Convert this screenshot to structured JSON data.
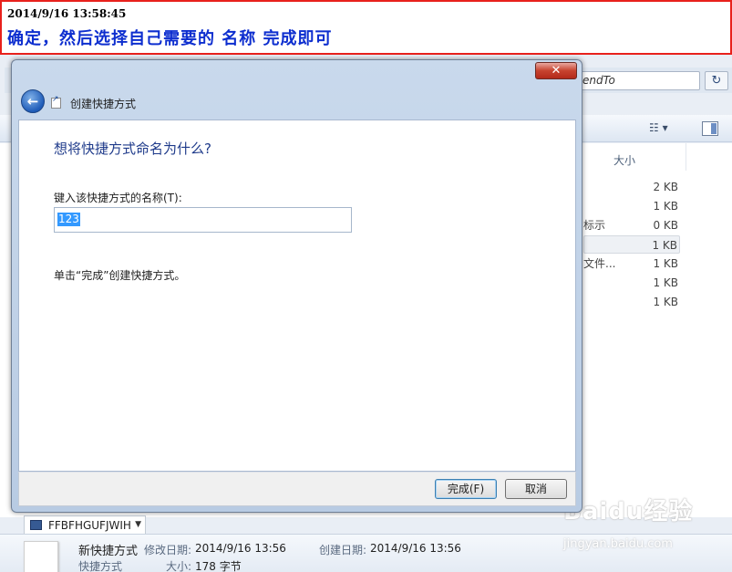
{
  "banner": {
    "timestamp": "2014/9/16 13:58:45",
    "caption": "确定，然后选择自己需要的 名称  完成即可"
  },
  "explorer": {
    "address_path": "endTo",
    "column_size": "大小",
    "rows": [
      {
        "prefix": "",
        "size": "2 KB"
      },
      {
        "prefix": "",
        "size": "1 KB"
      },
      {
        "prefix": "标示",
        "size": "0 KB"
      },
      {
        "prefix": "",
        "size": "1 KB"
      },
      {
        "prefix": "文件...",
        "size": "1 KB"
      },
      {
        "prefix": "",
        "size": "1 KB"
      },
      {
        "prefix": "",
        "size": "1 KB"
      }
    ],
    "computer_name": "FFBFHGUFJWIH",
    "details": {
      "file_name": "新快捷方式",
      "file_type": "快捷方式",
      "modified_label": "修改日期:",
      "modified_value": "2014/9/16 13:56",
      "created_label": "创建日期:",
      "created_value": "2014/9/16 13:56",
      "size_label": "大小:",
      "size_value": "178 字节"
    }
  },
  "dialog": {
    "title": "创建快捷方式",
    "question": "想将快捷方式命名为什么?",
    "input_label": "键入该快捷方式的名称(T):",
    "input_value": "123",
    "hint": "单击“完成”创建快捷方式。",
    "finish_button": "完成(F)",
    "cancel_button": "取消"
  },
  "watermark": {
    "logo": "Baidu经验",
    "url": "jingyan.baidu.com"
  }
}
